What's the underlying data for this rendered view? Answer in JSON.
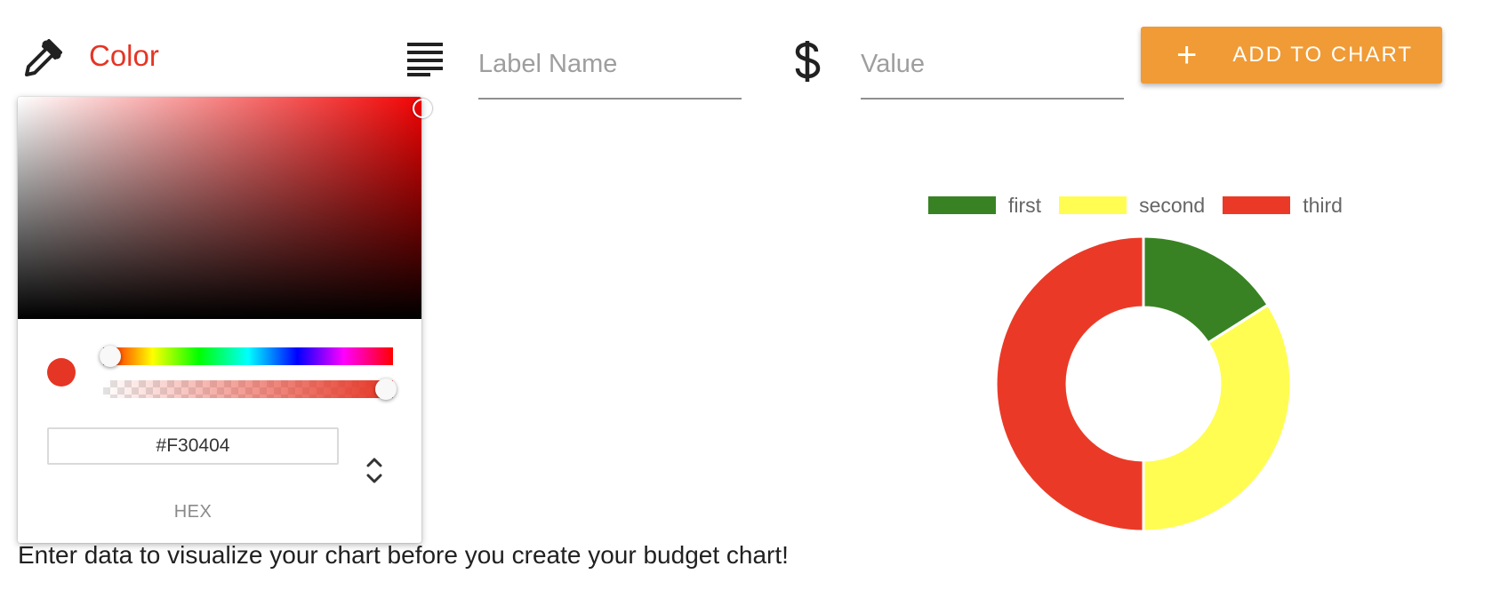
{
  "form": {
    "color_label": "Color",
    "label_placeholder": "Label Name",
    "value_placeholder": "Value",
    "add_button": {
      "icon": "+",
      "label": "ADD TO CHART"
    },
    "icons": [
      "eyedropper-icon",
      "text-lines-icon",
      "dollar-icon"
    ]
  },
  "color_picker": {
    "hex_value": "#F30404",
    "mode_label": "HEX",
    "hue_level": 0.0,
    "alpha_level": 1.0,
    "colors": {
      "selected": "#F30404",
      "swatch": "#E53524"
    }
  },
  "chart_data": {
    "type": "doughnut",
    "legend_position": "top",
    "labels": [
      "first",
      "second",
      "third"
    ],
    "values": [
      16,
      34,
      50
    ],
    "colors": [
      "#388223",
      "#FFFD52",
      "#EA3A27"
    ]
  },
  "footer": {
    "message": "Enter data to visualize your chart before you create your budget chart!"
  },
  "colors": {
    "accent_button": "#F09B35",
    "color_label": "#E53524"
  }
}
